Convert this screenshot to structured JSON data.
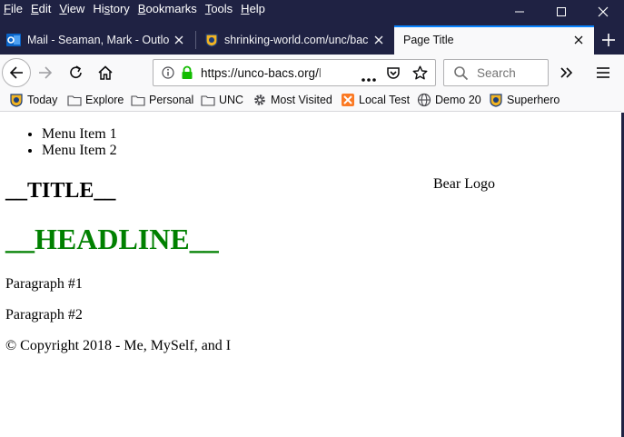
{
  "menubar": {
    "items": [
      {
        "ul": "F",
        "rest": "ile"
      },
      {
        "ul": "E",
        "rest": "dit"
      },
      {
        "ul": "V",
        "rest": "iew"
      },
      {
        "pre": "Hi",
        "ul": "s",
        "rest": "tory"
      },
      {
        "ul": "B",
        "rest": "ookmarks"
      },
      {
        "ul": "T",
        "rest": "ools"
      },
      {
        "ul": "H",
        "rest": "elp"
      }
    ]
  },
  "tabs": [
    {
      "title": "Mail - Seaman, Mark - Outloo",
      "icon": "outlook-icon"
    },
    {
      "title": "shrinking-world.com/unc/bac",
      "icon": "bear-shield-icon"
    },
    {
      "title": "Page Title",
      "icon": null,
      "active": true
    }
  ],
  "urlbar": {
    "url": "https://unco-bacs.org/",
    "url_dim": "l"
  },
  "searchbar": {
    "placeholder": "Search"
  },
  "bookmarks": [
    {
      "label": "Today",
      "icon": "bear-shield-icon"
    },
    {
      "label": "Explore",
      "icon": "folder-icon"
    },
    {
      "label": "Personal",
      "icon": "folder-icon"
    },
    {
      "label": "UNC",
      "icon": "folder-icon"
    },
    {
      "label": "Most Visited",
      "icon": "gear-icon"
    },
    {
      "label": "Local Test",
      "icon": "xampp-icon"
    },
    {
      "label": "Demo 20",
      "icon": "globe-icon"
    },
    {
      "label": "Superhero",
      "icon": "bear-shield-icon"
    }
  ],
  "page": {
    "menu": [
      "Menu Item 1",
      "Menu Item 2"
    ],
    "title": "__TITLE__",
    "logo": "Bear Logo",
    "headline": "__HEADLINE__",
    "paragraphs": [
      "Paragraph #1",
      "Paragraph #2"
    ],
    "copyright": "© Copyright 2018 - Me, MySelf, and I"
  },
  "colors": {
    "chrome_dark": "#1f2243",
    "toolbar": "#f9f9fa",
    "active_tab_accent": "#0a84ff",
    "secure_lock": "#12bc00",
    "headline": "#008000"
  }
}
